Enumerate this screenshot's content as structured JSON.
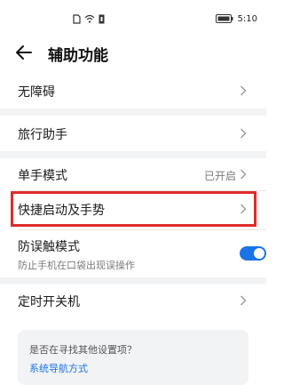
{
  "status_bar": {
    "time": "5:10",
    "icons": [
      "sim-card-icon",
      "wifi-icon",
      "notification-icon",
      "battery-icon"
    ]
  },
  "header": {
    "back_icon": "arrow-left-icon",
    "title": "辅助功能"
  },
  "settings": {
    "accessibility": {
      "label": "无障碍"
    },
    "travel_assistant": {
      "label": "旅行助手"
    },
    "one_hand_mode": {
      "label": "单手模式",
      "value": "已开启"
    },
    "quick_launch_gestures": {
      "label": "快捷启动及手势"
    },
    "accidental_touch": {
      "label": "防误触模式",
      "description": "防止手机在口袋出现误操作",
      "toggle_on": true
    },
    "scheduled_power": {
      "label": "定时开关机"
    }
  },
  "suggestion_card": {
    "question": "是否在寻找其他设置项？",
    "link": "系统导航方式"
  },
  "colors": {
    "accent": "#1a73e8",
    "highlight_border": "#e02b2b",
    "separator": "#f1f3f5"
  }
}
